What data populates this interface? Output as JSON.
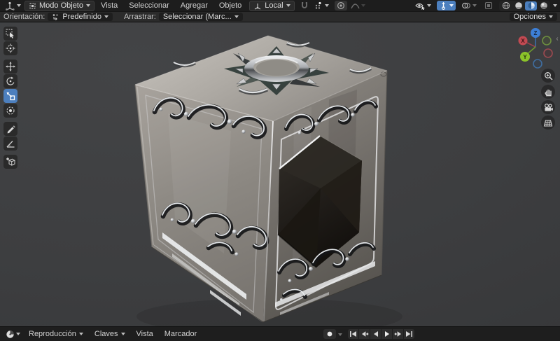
{
  "colors": {
    "accent": "#4c7fbe",
    "topbar_bg": "#1d1d1d",
    "toolsettings_bg": "#2b2b2b",
    "viewport_bg": "#3e3f41",
    "timeline_bg": "#1e1e1e",
    "axis_x": "#c24a52",
    "axis_y": "#8bc32a",
    "axis_z": "#3d7fd6"
  },
  "icons": {
    "chevron_down": "css-triangle",
    "editor_3d_viewport": "svg",
    "timeline_editor_clock": "svg",
    "snap_magnet": "svg",
    "proportional_editing": "svg",
    "falloff_curve": "svg"
  },
  "menubar": {
    "mode_button": {
      "label": "Modo Objeto"
    },
    "menus": [
      {
        "label": "Vista"
      },
      {
        "label": "Seleccionar"
      },
      {
        "label": "Agregar"
      },
      {
        "label": "Objeto"
      }
    ],
    "orientation_button": {
      "label": "Local"
    }
  },
  "tool_settings": {
    "orientation_label": "Orientación:",
    "orientation_value": "Predefinido",
    "drag_label": "Arrastrar:",
    "drag_value": "Seleccionar (Marc...",
    "options_button": "Opciones"
  },
  "gizmo_axes": {
    "x": "X",
    "y": "Y",
    "z": "Z"
  },
  "timeline": {
    "playback_menu": "Reproducción",
    "keys_menu": "Claves",
    "view_menu": "Vista",
    "marker_menu": "Marcador"
  }
}
